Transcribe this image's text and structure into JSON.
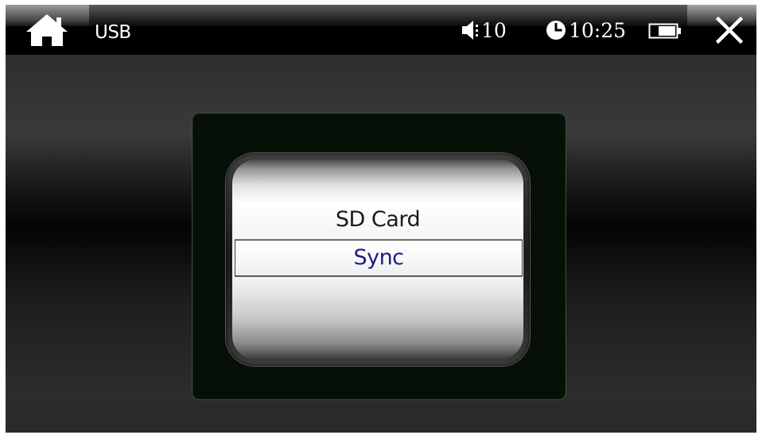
{
  "topbar": {
    "home_icon": "home-icon",
    "title": "USB",
    "volume_icon": "speaker-volume-icon",
    "volume_level": "10",
    "clock_icon": "clock-icon",
    "time": "10:25",
    "battery_icon": "battery-icon",
    "close_icon": "close-icon"
  },
  "dialog": {
    "options": [
      {
        "label": "SD Card",
        "selected": false
      },
      {
        "label": "Sync",
        "selected": true
      }
    ],
    "selected_color": "#1c1c8c"
  }
}
